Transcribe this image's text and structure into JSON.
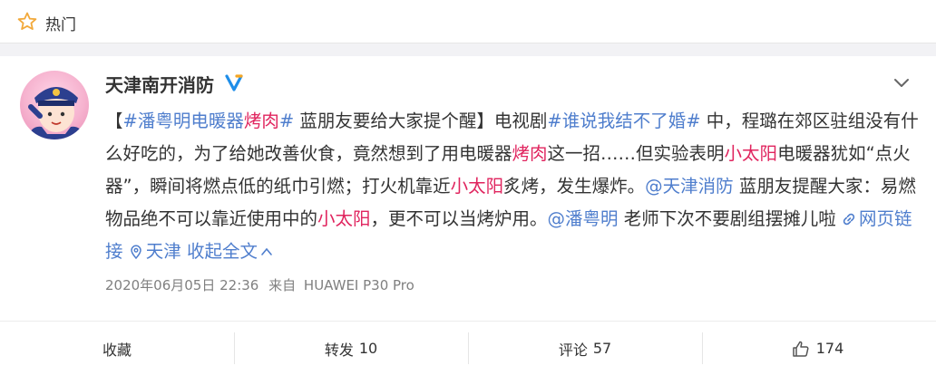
{
  "header": {
    "title": "热门",
    "icon": "star-icon"
  },
  "post": {
    "author": "天津南开消防",
    "verified": true,
    "content": {
      "p1": "【",
      "topic1a": "#潘粤明电暖器",
      "topic1b": "烤肉",
      "topic1c": "#",
      "p2": " 蓝朋友要给大家提个醒】电视剧",
      "topic2": "#谁说我结不了婚#",
      "p3": " 中，程璐在郊区驻组没有什么好吃的，为了给她改善伙食，竟然想到了用电暖器",
      "hl1": "烤肉",
      "p4": "这一招……但实验表明",
      "hl2": "小太阳",
      "p5": "电暖器犹如“点火器”，瞬间将燃点低的纸巾引燃；打火机靠近",
      "hl3": "小太阳",
      "p6": "炙烤，发生爆炸。",
      "mention1": "@天津消防",
      "p7": " 蓝朋友提醒大家：易燃物品绝不可以靠近使用中的",
      "hl4": "小太阳",
      "p8": "，更不可以当烤炉用。",
      "mention2": "@潘粤明",
      "p9": " 老师下次不要剧组摆摊儿啦 ",
      "weblink": "网页链接",
      "location": "天津",
      "collapse": "收起全文"
    },
    "timestamp": "2020年06月05日 22:36",
    "source_prefix": "来自",
    "source": "HUAWEI P30 Pro"
  },
  "actions": {
    "favorite": "收藏",
    "repost_label": "转发",
    "repost_count": "10",
    "comment_label": "评论",
    "comment_count": "57",
    "like_count": "174"
  },
  "colors": {
    "link": "#4f7ecd",
    "highlight": "#e0245e",
    "verified": "#1f8ee9",
    "star": "#f2a93b"
  }
}
